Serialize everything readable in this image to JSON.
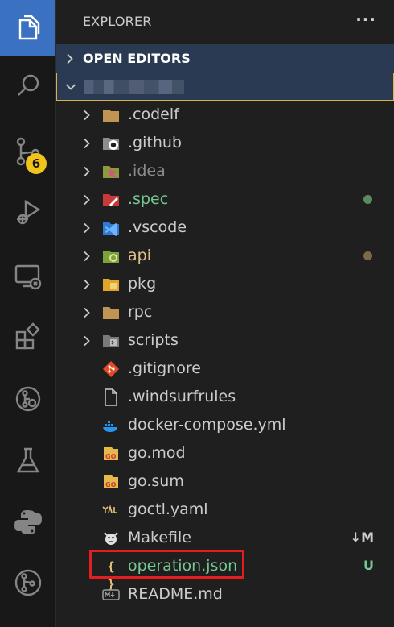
{
  "sidebar": {
    "title": "EXPLORER",
    "more": "···",
    "open_editors": "OPEN EDITORS"
  },
  "activity": {
    "scm_badge": "6"
  },
  "tree": {
    "items": [
      {
        "name": ".codelf",
        "color": "#cccccc"
      },
      {
        "name": ".github",
        "color": "#cccccc"
      },
      {
        "name": ".idea",
        "color": "#8b8b8b"
      },
      {
        "name": ".spec",
        "color": "#73c991"
      },
      {
        "name": ".vscode",
        "color": "#cccccc"
      },
      {
        "name": "api",
        "color": "#e2c08d"
      },
      {
        "name": "pkg",
        "color": "#cccccc"
      },
      {
        "name": "rpc",
        "color": "#cccccc"
      },
      {
        "name": "scripts",
        "color": "#cccccc"
      },
      {
        "name": ".gitignore",
        "color": "#cccccc"
      },
      {
        "name": ".windsurfrules",
        "color": "#cccccc"
      },
      {
        "name": "docker-compose.yml",
        "color": "#cccccc"
      },
      {
        "name": "go.mod",
        "color": "#cccccc"
      },
      {
        "name": "go.sum",
        "color": "#cccccc"
      },
      {
        "name": "goctl.yaml",
        "color": "#cccccc"
      },
      {
        "name": "Makefile",
        "color": "#cccccc",
        "status": "M"
      },
      {
        "name": "operation.json",
        "color": "#73c991",
        "status": "U"
      },
      {
        "name": "README.md",
        "color": "#cccccc"
      }
    ]
  },
  "colors": {
    "accent": "#3a71c1",
    "badge": "#f0c419",
    "untracked": "#73c991",
    "modified": "#e2c08d",
    "highlight_box": "#e41e1e"
  }
}
